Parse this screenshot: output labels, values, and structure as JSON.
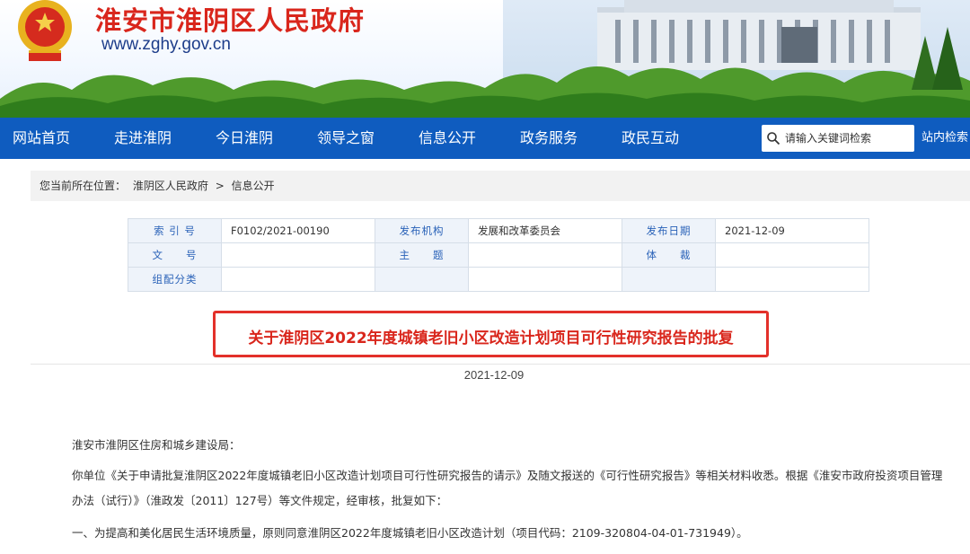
{
  "site": {
    "title": "淮安市淮阴区人民政府",
    "url": "www.zghy.gov.cn"
  },
  "nav": {
    "items": [
      "网站首页",
      "走进淮阴",
      "今日淮阴",
      "领导之窗",
      "信息公开",
      "政务服务",
      "政民互动"
    ],
    "search_placeholder": "请输入关键词检索",
    "search_button": "站内检索"
  },
  "breadcrumb": {
    "prefix": "您当前所在位置：",
    "items": [
      "淮阴区人民政府",
      ">",
      "信息公开"
    ]
  },
  "info_table": {
    "rows": [
      [
        {
          "k": "索 引 号",
          "v": "F0102/2021-00190"
        },
        {
          "k": "发布机构",
          "v": "发展和改革委员会"
        },
        {
          "k": "发布日期",
          "v": "2021-12-09"
        }
      ],
      [
        {
          "k": "文　　号",
          "v": ""
        },
        {
          "k": "主　　题",
          "v": ""
        },
        {
          "k": "体　　裁",
          "v": ""
        }
      ],
      [
        {
          "k": "组配分类",
          "v": ""
        },
        {
          "k": "",
          "v": ""
        },
        {
          "k": "",
          "v": ""
        }
      ]
    ]
  },
  "document": {
    "title": "关于淮阴区2022年度城镇老旧小区改造计划项目可行性研究报告的批复",
    "date": "2021-12-09",
    "addressee": "淮安市淮阴区住房和城乡建设局：",
    "para1_line1": "你单位《关于申请批复淮阴区2022年度城镇老旧小区改造计划项目可行性研究报告的请示》及随文报送的《可行性研究报告》等相关材料收悉。根据《淮安市政府投资项目管理",
    "para1_line2": "办法（试行）》（淮政发〔2011〕127号）等文件规定，经审核，批复如下：",
    "para2": "一、为提高和美化居民生活环境质量，原则同意淮阴区2022年度城镇老旧小区改造计划（项目代码：2109-320804-04-01-731949）。"
  },
  "colors": {
    "nav_bg": "#0f5cbf",
    "title_red": "#d9261c",
    "highlight_border": "#e3302a"
  }
}
